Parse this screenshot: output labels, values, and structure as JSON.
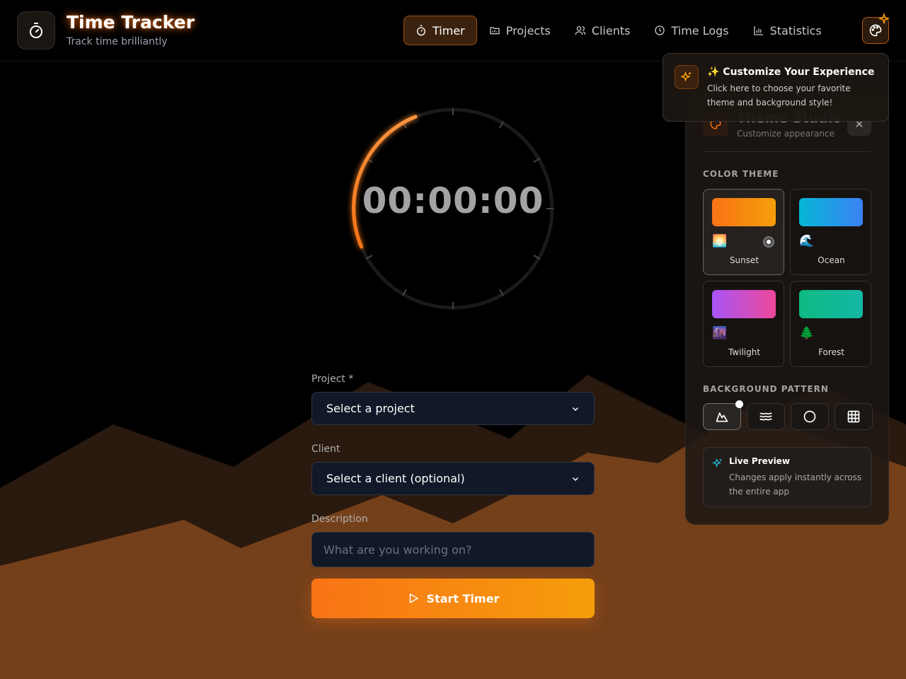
{
  "app": {
    "title": "Time Tracker",
    "subtitle": "Track time brilliantly"
  },
  "nav": {
    "items": [
      {
        "label": "Timer",
        "icon": "timer-icon",
        "active": true
      },
      {
        "label": "Projects",
        "icon": "folder-icon",
        "active": false
      },
      {
        "label": "Clients",
        "icon": "users-icon",
        "active": false
      },
      {
        "label": "Time Logs",
        "icon": "clock-icon",
        "active": false
      },
      {
        "label": "Statistics",
        "icon": "bar-chart-icon",
        "active": false
      }
    ]
  },
  "timer": {
    "display": "00:00:00"
  },
  "form": {
    "project_label": "Project *",
    "project_value": "Select a project",
    "client_label": "Client",
    "client_value": "Select a client (optional)",
    "description_label": "Description",
    "description_placeholder": "What are you working on?",
    "start_label": "Start Timer"
  },
  "tooltip": {
    "title": "✨ Customize Your Experience",
    "text": "Click here to choose your favorite theme and background style!"
  },
  "panel": {
    "title": "Theme Studio",
    "subtitle": "Customize appearance",
    "color_theme_label": "COLOR THEME",
    "themes": [
      {
        "name": "Sunset",
        "emoji": "🌅",
        "selected": true,
        "gradient": [
          "#f97316",
          "#f59e0b"
        ]
      },
      {
        "name": "Ocean",
        "emoji": "🌊",
        "selected": false,
        "gradient": [
          "#06b6d4",
          "#3b82f6"
        ]
      },
      {
        "name": "Twilight",
        "emoji": "🌆",
        "selected": false,
        "gradient": [
          "#a855f7",
          "#ec4899"
        ]
      },
      {
        "name": "Forest",
        "emoji": "🌲",
        "selected": false,
        "gradient": [
          "#10b981",
          "#14b8a6"
        ]
      }
    ],
    "background_pattern_label": "BACKGROUND PATTERN",
    "patterns": [
      {
        "icon": "mountain-icon",
        "selected": true
      },
      {
        "icon": "waves-icon",
        "selected": false
      },
      {
        "icon": "circle-icon",
        "selected": false
      },
      {
        "icon": "grid-icon",
        "selected": false
      }
    ],
    "live_preview_title": "Live Preview",
    "live_preview_text": "Changes apply instantly across the entire app"
  },
  "colors": {
    "accent": "#f97316",
    "accent_secondary": "#f59e0b",
    "background": "#000000",
    "mountain": "#74401a"
  }
}
